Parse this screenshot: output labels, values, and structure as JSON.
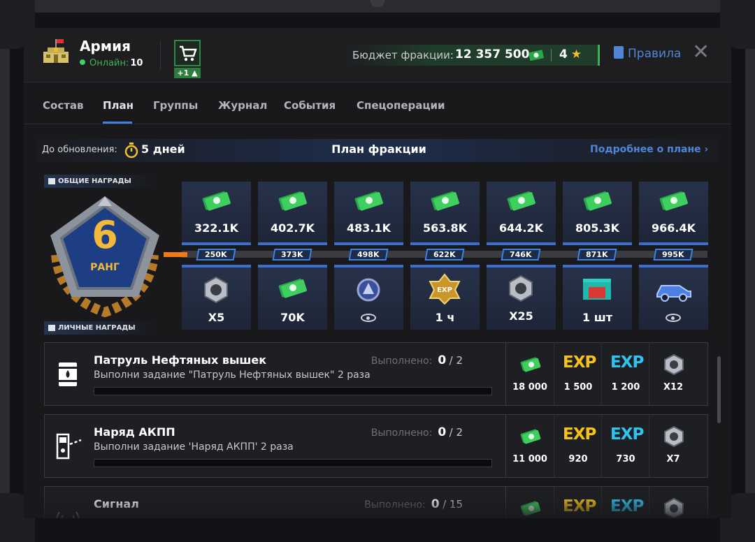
{
  "header": {
    "title": "Армия",
    "online_label": "Онлайн:",
    "online_count": "10",
    "cart_badge": "+1",
    "budget_label": "Бюджет фракции:",
    "budget_value": "12 357 500",
    "stars": "4",
    "rules_label": "Правила"
  },
  "tabs": [
    "Состав",
    "План",
    "Группы",
    "Журнал",
    "События",
    "Спецоперации"
  ],
  "active_tab": "План",
  "plan": {
    "update_label": "До обновления:",
    "update_value": "5 дней",
    "title": "План фракции",
    "more_link": "Подробнее о плане"
  },
  "rewards": {
    "common_label": "ОБЩИЕ НАГРАДЫ",
    "personal_label": "ЛИЧНЫЕ НАГРАДЫ",
    "rank_number": "6",
    "rank_label": "РАНГ",
    "common": [
      "322.1K",
      "402.7K",
      "483.1K",
      "563.8K",
      "644.2K",
      "805.3K",
      "966.4K"
    ],
    "thresholds": [
      "250K",
      "373K",
      "498K",
      "622K",
      "746K",
      "871K",
      "995K"
    ],
    "personal": [
      {
        "icon": "nut-icon",
        "value": "X5"
      },
      {
        "icon": "money-icon",
        "value": "70K"
      },
      {
        "icon": "badge-icon",
        "value": ""
      },
      {
        "icon": "exp-boost-icon",
        "value": "1 ч"
      },
      {
        "icon": "nut-icon",
        "value": "X25"
      },
      {
        "icon": "garage-icon",
        "value": "1 шт"
      },
      {
        "icon": "vehicle-icon",
        "value": ""
      }
    ]
  },
  "tasks": [
    {
      "name": "Патруль Нефтяных вышек",
      "desc": "Выполни задание \"Патруль Нефтяных вышек\" 2 раза",
      "done_label": "Выполнено:",
      "done": "0",
      "total": "/ 2",
      "rewards": [
        "18 000",
        "1 500",
        "1 200",
        "X12"
      ]
    },
    {
      "name": "Наряд АКПП",
      "desc": "Выполни задание 'Наряд АКПП' 2 раза",
      "done_label": "Выполнено:",
      "done": "0",
      "total": "/ 2",
      "rewards": [
        "11 000",
        "920",
        "730",
        "X7"
      ]
    },
    {
      "name": "Сигнал",
      "desc": "",
      "done_label": "Выполнено:",
      "done": "0",
      "total": "/ 15",
      "rewards": [
        "",
        "",
        "",
        ""
      ]
    }
  ],
  "exp_label": "EXP",
  "colors": {
    "accent": "#3f82e4",
    "money": "#3ab05a",
    "exp_yellow": "#f6c21a",
    "exp_blue": "#2fc3f0",
    "rank_gold": "#f3b93a"
  }
}
